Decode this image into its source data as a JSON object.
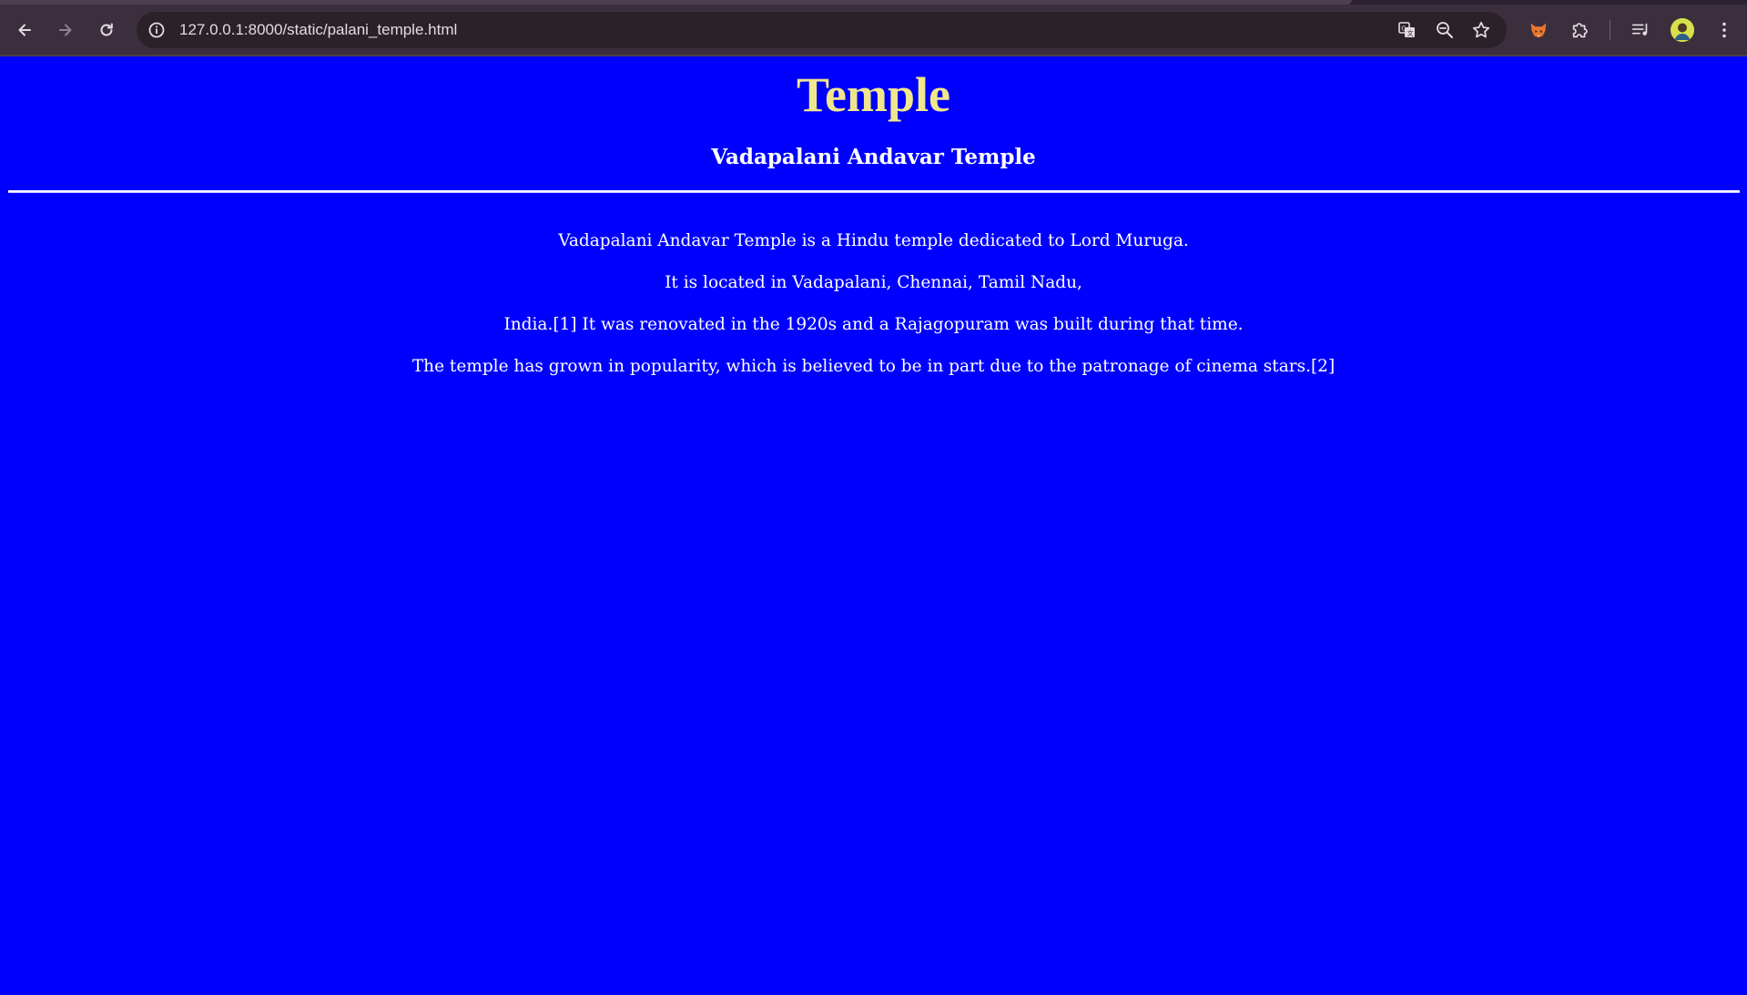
{
  "browser": {
    "url": "127.0.0.1:8000/static/palani_temple.html"
  },
  "page": {
    "title": "Temple",
    "subtitle": "Vadapalani Andavar Temple",
    "paragraphs": [
      "Vadapalani Andavar Temple is a Hindu temple dedicated to Lord Muruga.",
      "It is located in Vadapalani, Chennai, Tamil Nadu,",
      "India.[1] It was renovated in the 1920s and a Rajagopuram was built during that time.",
      "The temple has grown in popularity, which is believed to be in part due to the patronage of cinema stars.[2]"
    ]
  },
  "colors": {
    "background": "#0000ff",
    "title": "#f0e68c",
    "text": "#ffffff",
    "browser_chrome": "#3c2f3d"
  },
  "icons": {
    "back": "back-arrow-icon",
    "forward": "forward-arrow-icon",
    "reload": "reload-icon",
    "site_info": "info-icon",
    "translate": "translate-icon",
    "zoom": "zoom-out-icon",
    "bookmark": "star-icon",
    "extension_fox": "fox-extension-icon",
    "extensions": "puzzle-icon",
    "media": "media-control-icon",
    "profile": "avatar",
    "menu": "kebab-menu-icon"
  }
}
